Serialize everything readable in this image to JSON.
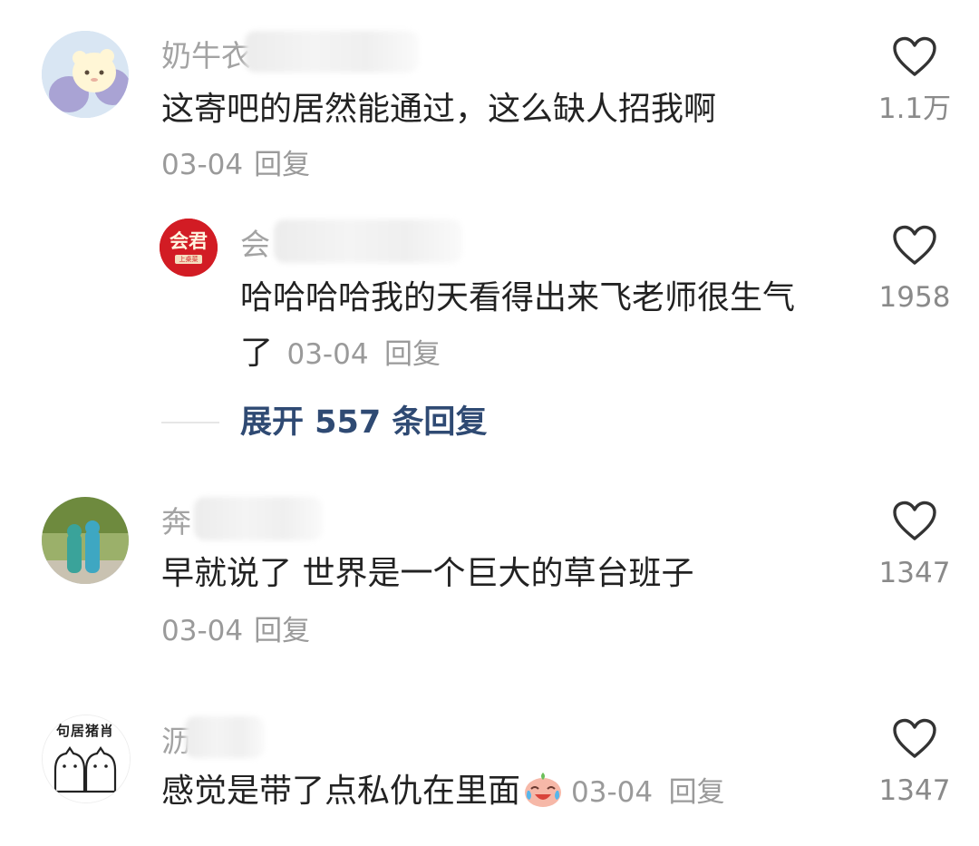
{
  "comments": [
    {
      "username": "奶牛衣",
      "text": "这寄吧的居然能通过，这么缺人招我啊",
      "date": "03-04",
      "reply_label": "回复",
      "likes": "1.1万",
      "avatar_icon": "cartoon-bear-avatar"
    },
    {
      "username": "会",
      "text_line1": "哈哈哈哈我的天看得出来飞老师很生气",
      "text_line2": "了",
      "date": "03-04",
      "reply_label": "回复",
      "likes": "1958",
      "avatar_icon": "huijun-logo-avatar",
      "avatar_text": "会君",
      "avatar_subtext": "上桌菜",
      "expand_label": "展开 557 条回复"
    },
    {
      "username": "奔",
      "text": "早就说了 世界是一个巨大的草台班子",
      "date": "03-04",
      "reply_label": "回复",
      "likes": "1347",
      "avatar_icon": "green-figures-avatar"
    },
    {
      "username": "沥",
      "text": "感觉是带了点私仇在里面",
      "emoji_icon": "crying-laughing-emoji",
      "date": "03-04",
      "reply_label": "回复",
      "likes": "1347",
      "avatar_icon": "doodle-cats-avatar",
      "avatar_text": "句居猪肖"
    }
  ],
  "colors": {
    "username": "#a3a3a3",
    "text": "#222222",
    "meta": "#9a9a9a",
    "expand": "#2f4a73",
    "huijun_red": "#d21c24"
  }
}
